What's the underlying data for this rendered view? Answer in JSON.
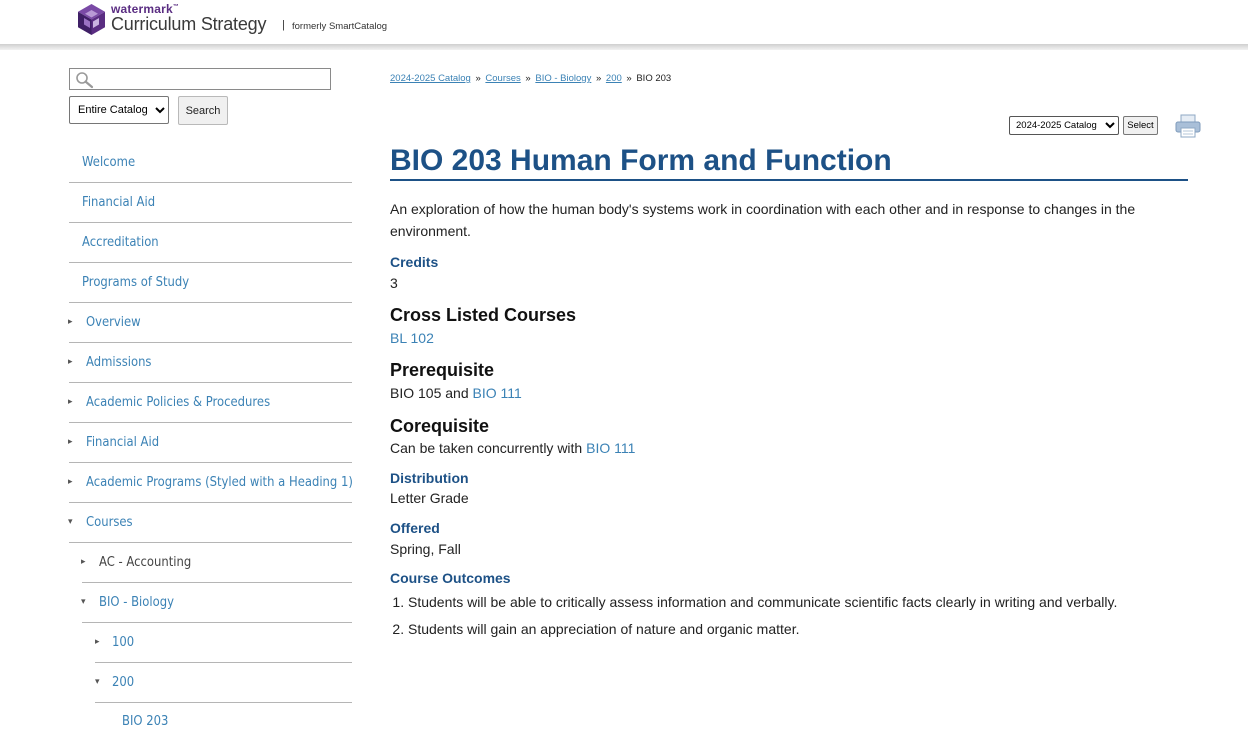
{
  "header": {
    "brand_small": "watermark",
    "brand_tm": "™",
    "brand_big": "Curriculum Strategy",
    "separator": "|",
    "formerly": "formerly SmartCatalog"
  },
  "search": {
    "value": "",
    "scope_selected": "Entire Catalog",
    "button_label": "Search"
  },
  "nav": {
    "items": [
      {
        "label": "Welcome"
      },
      {
        "label": "Financial Aid"
      },
      {
        "label": "Accreditation"
      },
      {
        "label": "Programs of Study"
      },
      {
        "label": "Overview",
        "arrow": "▸"
      },
      {
        "label": "Admissions",
        "arrow": "▸"
      },
      {
        "label": "Academic Policies & Procedures",
        "arrow": "▸"
      },
      {
        "label": "Financial Aid",
        "arrow": "▸"
      },
      {
        "label": "Academic Programs (Styled with a Heading 1)",
        "arrow": "▸"
      },
      {
        "label": "Courses",
        "arrow": "▾"
      },
      {
        "label": "AC - Accounting",
        "arrow": "▸"
      },
      {
        "label": "BIO - Biology",
        "arrow": "▾"
      },
      {
        "label": "100",
        "arrow": "▸"
      },
      {
        "label": "200",
        "arrow": "▾"
      },
      {
        "label": "BIO 203"
      }
    ]
  },
  "breadcrumb": {
    "items": [
      "2024-2025 Catalog",
      "Courses",
      "BIO - Biology",
      "200"
    ],
    "separator": "»",
    "current": "BIO 203"
  },
  "catalog_picker": {
    "selected": "2024-2025 Catalog",
    "button_label": "Select"
  },
  "course": {
    "title": "BIO 203 Human Form and Function",
    "description": "An exploration of how the human body's systems work in coordination with each other and in response to changes in the environment.",
    "credits_label": "Credits",
    "credits_value": "3",
    "cross_listed_label": "Cross Listed Courses",
    "cross_listed_link": "BL 102",
    "prereq_label": "Prerequisite",
    "prereq_text": "BIO 105 and ",
    "prereq_link": "BIO 111",
    "coreq_label": "Corequisite",
    "coreq_text": "Can be taken concurrently with ",
    "coreq_link": "BIO 111",
    "distribution_label": "Distribution",
    "distribution_value": "Letter Grade",
    "offered_label": "Offered",
    "offered_value": "Spring, Fall",
    "outcomes_label": "Course Outcomes",
    "outcomes": [
      "Students will be able to critically assess information and communicate scientific facts clearly in writing and verbally.",
      "Students will gain an appreciation of nature and organic matter."
    ]
  },
  "colors": {
    "heading_blue": "#1d5186",
    "link_blue": "#3b82b5",
    "brand_purple": "#5a2d82"
  }
}
